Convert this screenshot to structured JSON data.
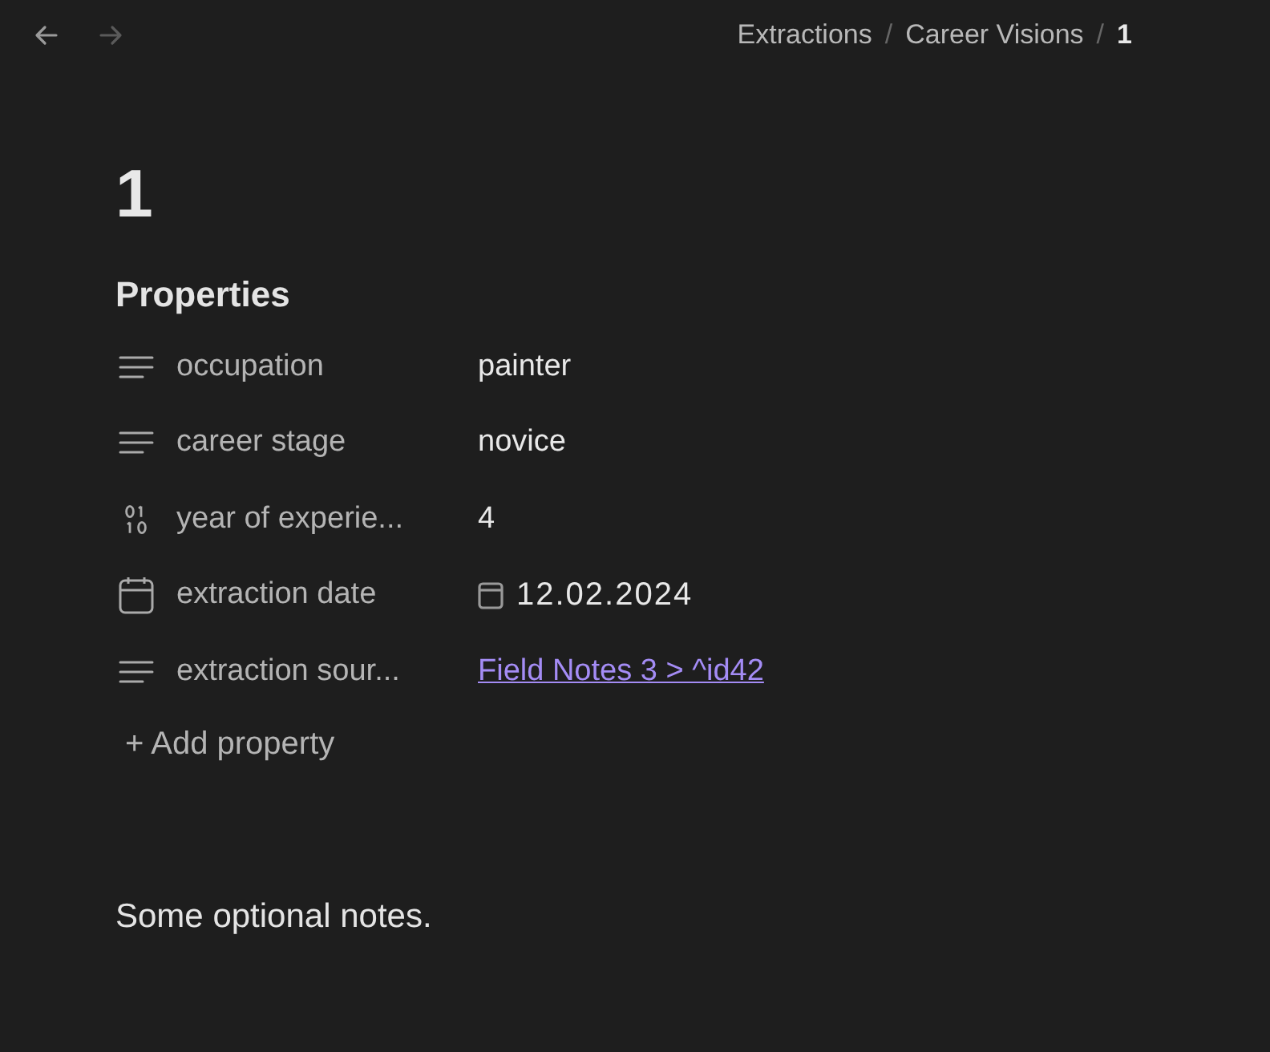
{
  "nav": {
    "back_disabled": false,
    "forward_disabled": true
  },
  "breadcrumb": [
    {
      "label": "Extractions",
      "current": false
    },
    {
      "label": "Career Visions",
      "current": false
    },
    {
      "label": "1",
      "current": true
    }
  ],
  "breadcrumb_separator": "/",
  "title": "1",
  "properties_heading": "Properties",
  "properties": [
    {
      "kind": "text",
      "key": "occupation",
      "value": "painter"
    },
    {
      "kind": "text",
      "key": "career stage",
      "value": "novice"
    },
    {
      "kind": "number",
      "key": "year of experie...",
      "value": "4"
    },
    {
      "kind": "date",
      "key": "extraction date",
      "value": "12.02.2024"
    },
    {
      "kind": "link",
      "key": "extraction sour...",
      "value": "Field Notes 3 > ^id42"
    }
  ],
  "add_property": {
    "icon": "+",
    "label": "Add property"
  },
  "notes": "Some optional notes."
}
